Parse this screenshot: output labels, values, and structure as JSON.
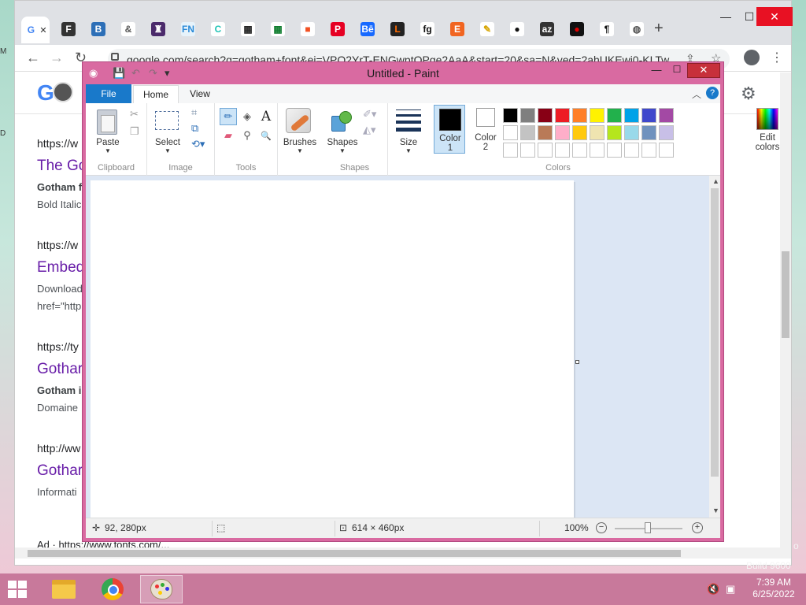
{
  "browser": {
    "tabs": [
      {
        "name": "tab-google",
        "glyph": "G",
        "bg": "#ffffff",
        "fg": "#4285f4"
      },
      {
        "name": "tab-fontsquirrel",
        "glyph": "F",
        "bg": "#333333",
        "fg": "#ffffff"
      },
      {
        "name": "tab-b",
        "glyph": "B",
        "bg": "#2d6fb7",
        "fg": "#ffffff"
      },
      {
        "name": "tab-ampersand",
        "glyph": "&",
        "bg": "#ffffff",
        "fg": "#555555"
      },
      {
        "name": "tab-fontspace",
        "glyph": "♜",
        "bg": "#4b2a6b",
        "fg": "#ffffff"
      },
      {
        "name": "tab-fn",
        "glyph": "FN",
        "bg": "#e7f3fb",
        "fg": "#2a8ad8"
      },
      {
        "name": "tab-canva",
        "glyph": "C",
        "bg": "#ffffff",
        "fg": "#1fc3b5"
      },
      {
        "name": "tab-grid1",
        "glyph": "▦",
        "bg": "#ffffff",
        "fg": "#222222"
      },
      {
        "name": "tab-grid2",
        "glyph": "▦",
        "bg": "#ffffff",
        "fg": "#0a7a2a"
      },
      {
        "name": "tab-microsoft",
        "glyph": "■",
        "bg": "#ffffff",
        "fg": "#f25022"
      },
      {
        "name": "tab-pinterest",
        "glyph": "P",
        "bg": "#e60023",
        "fg": "#ffffff"
      },
      {
        "name": "tab-behance",
        "glyph": "Bē",
        "bg": "#1769ff",
        "fg": "#ffffff"
      },
      {
        "name": "tab-l",
        "glyph": "L",
        "bg": "#222222",
        "fg": "#ff6a00"
      },
      {
        "name": "tab-fg",
        "glyph": "fg",
        "bg": "#ffffff",
        "fg": "#111111"
      },
      {
        "name": "tab-etsy",
        "glyph": "E",
        "bg": "#f16521",
        "fg": "#ffffff"
      },
      {
        "name": "tab-pen",
        "glyph": "✎",
        "bg": "#ffffff",
        "fg": "#d6a400"
      },
      {
        "name": "tab-github",
        "glyph": "●",
        "bg": "#ffffff",
        "fg": "#111111"
      },
      {
        "name": "tab-az",
        "glyph": "az",
        "bg": "#333333",
        "fg": "#ffffff"
      },
      {
        "name": "tab-record",
        "glyph": "●",
        "bg": "#111111",
        "fg": "#e00000"
      },
      {
        "name": "tab-pilcrow",
        "glyph": "¶",
        "bg": "#ffffff",
        "fg": "#111111"
      },
      {
        "name": "tab-globe",
        "glyph": "◍",
        "bg": "#ffffff",
        "fg": "#555555"
      }
    ],
    "new_tab": "+",
    "minimize": "—",
    "maximize": "☐",
    "close": "✕",
    "back": "←",
    "forward": "→",
    "reload": "↻",
    "url": "google.com/search?q=gotham+font&ei=VPO2YrT-ENGwptQPge2AaA&start=20&sa=N&ved=2ahUKEwi0-KLTw...",
    "share": "⇪",
    "star": "☆",
    "menu": "⋮"
  },
  "google": {
    "logo": "Go",
    "settings": "⚙",
    "results": [
      {
        "cite": "https://w",
        "title": "The Go",
        "snippet_bold": "Gotham f",
        "snippet": "Bold Italic"
      },
      {
        "cite": "https://w",
        "title": "Embed",
        "snippet_bold": "",
        "snippet": "Download",
        "snippet2": "href=\"http"
      },
      {
        "cite": "https://ty",
        "title": "Gothar",
        "snippet_bold": "Gotham i",
        "snippet": "Domaine"
      },
      {
        "cite": "http://ww",
        "title": "Gothar",
        "snippet_bold": "",
        "snippet": "Informati"
      }
    ],
    "ad": "Ad · https://www.fonts.com/..."
  },
  "paint": {
    "title": "Untitled - Paint",
    "qat_save": "💾",
    "qat_undo": "↶",
    "qat_redo": "↷",
    "qat_more": "▾",
    "minimize": "—",
    "maximize": "☐",
    "close": "✕",
    "tabs": {
      "file": "File",
      "home": "Home",
      "view": "View"
    },
    "collapse": "︿",
    "help": "?",
    "groups": {
      "clipboard": "Clipboard",
      "image": "Image",
      "tools": "Tools",
      "shapes": "Shapes",
      "colors": "Colors"
    },
    "buttons": {
      "paste": "Paste",
      "select": "Select",
      "brushes": "Brushes",
      "shapes": "Shapes",
      "size": "Size",
      "color1_line1": "Color",
      "color1_line2": "1",
      "color2_line1": "Color",
      "color2_line2": "2",
      "edit_colors_line1": "Edit",
      "edit_colors_line2": "colors"
    },
    "tools": {
      "pencil": "✏",
      "fill": "◈",
      "text": "A",
      "eraser": "▰",
      "picker": "⚲",
      "magnifier": "🔍"
    },
    "palette_row1": [
      "#000000",
      "#7f7f7f",
      "#880015",
      "#ed1c24",
      "#ff7f27",
      "#fff200",
      "#22b14c",
      "#00a2e8",
      "#3f48cc",
      "#a349a4"
    ],
    "palette_row2": [
      "#ffffff",
      "#c3c3c3",
      "#b97a57",
      "#ffaec9",
      "#ffc90e",
      "#efe4b0",
      "#b5e61d",
      "#99d9ea",
      "#7092be",
      "#c8bfe7"
    ],
    "palette_row3": [
      "#ffffff",
      "#ffffff",
      "#ffffff",
      "#ffffff",
      "#ffffff",
      "#ffffff",
      "#ffffff",
      "#ffffff",
      "#ffffff",
      "#ffffff"
    ],
    "status": {
      "cursor_pos": "92, 280px",
      "canvas_size": "614 × 460px",
      "zoom": "100%",
      "zoom_level": 1.0
    }
  },
  "taskbar": {
    "time": "7:39 AM",
    "date": "6/25/2022",
    "build": "Build 9600"
  }
}
